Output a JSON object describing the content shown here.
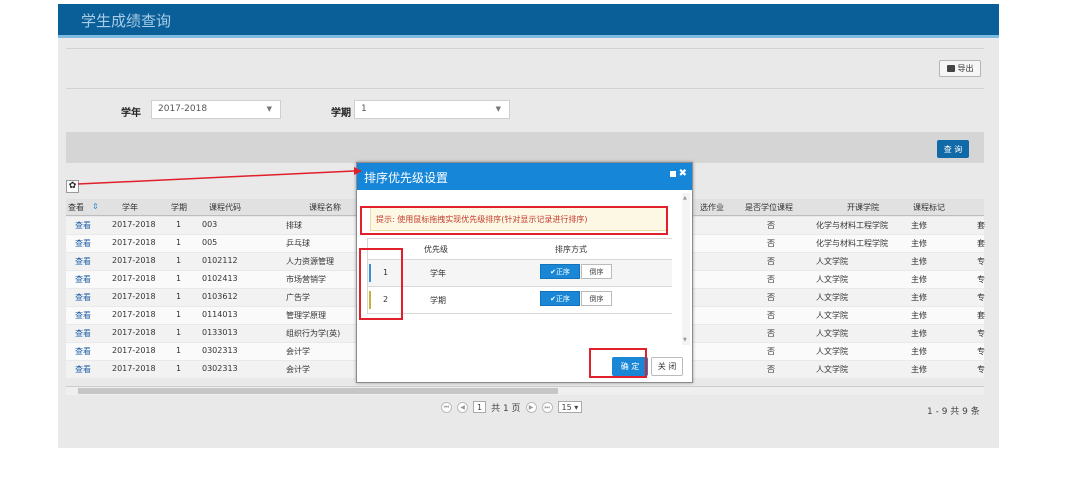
{
  "app": {
    "title": "学生成绩查询"
  },
  "toolbar": {
    "export_label": "导出",
    "query_label": "查 询"
  },
  "filters": {
    "year_label": "学年",
    "year_value": "2017-2018",
    "term_label": "学期",
    "term_value": "1"
  },
  "grid": {
    "columns": [
      "查看",
      "学年",
      "学期",
      "课程代码",
      "课程名称",
      "选作业",
      "是否学位课程",
      "开课学院",
      "课程标记"
    ],
    "rows": [
      [
        "查看",
        "2017-2018",
        "1",
        "003",
        "排球",
        "否",
        "化学与材料工程学院",
        "主修"
      ],
      [
        "查看",
        "2017-2018",
        "1",
        "005",
        "乒乓球",
        "否",
        "化学与材料工程学院",
        "主修"
      ],
      [
        "查看",
        "2017-2018",
        "1",
        "0102112",
        "人力资源管理",
        "否",
        "人文学院",
        "主修"
      ],
      [
        "查看",
        "2017-2018",
        "1",
        "0102413",
        "市场营销学",
        "否",
        "人文学院",
        "主修"
      ],
      [
        "查看",
        "2017-2018",
        "1",
        "0103612",
        "广告学",
        "否",
        "人文学院",
        "主修"
      ],
      [
        "查看",
        "2017-2018",
        "1",
        "0114013",
        "管理学原理",
        "否",
        "人文学院",
        "主修"
      ],
      [
        "查看",
        "2017-2018",
        "1",
        "0133013",
        "组织行为学(英)",
        "否",
        "人文学院",
        "主修"
      ],
      [
        "查看",
        "2017-2018",
        "1",
        "0302313",
        "会计学",
        "否",
        "人文学院",
        "主修"
      ],
      [
        "查看",
        "2017-2018",
        "1",
        "0302313",
        "会计学",
        "否",
        "人文学院",
        "主修"
      ]
    ],
    "right_edge": [
      "套",
      "套",
      "专",
      "专",
      "专",
      "套",
      "专",
      "专",
      "专"
    ]
  },
  "pager": {
    "page_value": "1",
    "page_text": "共 1 页",
    "page_size": "15",
    "summary": "1 - 9  共 9 条"
  },
  "modal": {
    "title": "排序优先级设置",
    "tip": "提示: 使用鼠标拖拽实现优先级排序(针对显示记录进行排序)",
    "col_priority": "优先级",
    "col_order": "排序方式",
    "rows": [
      {
        "num": "1",
        "name": "学年",
        "asc": "正序",
        "desc": "倒序"
      },
      {
        "num": "2",
        "name": "学期",
        "asc": "正序",
        "desc": "倒序"
      }
    ],
    "ok_label": "确 定",
    "close_label": "关 闭"
  },
  "colors": {
    "topbar": "#0a5f99",
    "accent": "#1686d8",
    "highlight": "#e0202a"
  }
}
